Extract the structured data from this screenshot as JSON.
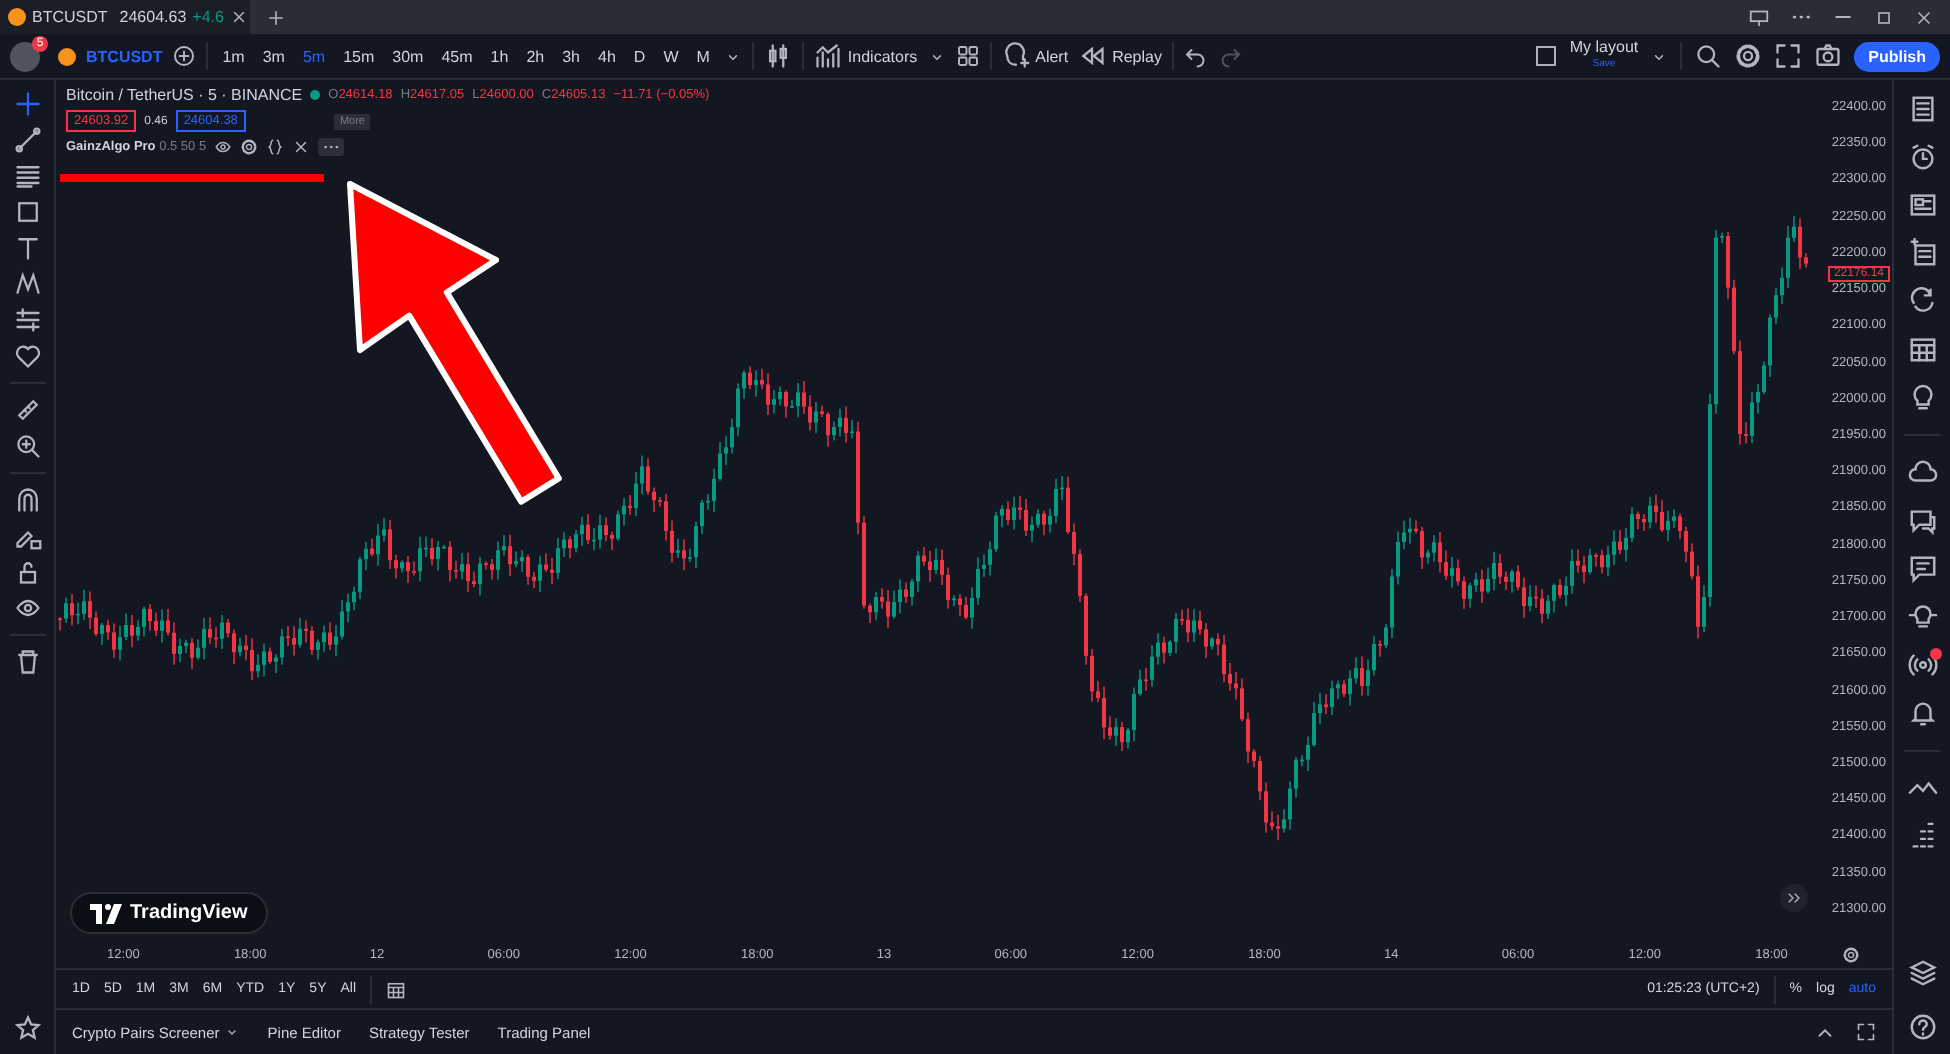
{
  "title_bar": {
    "tab": {
      "symbol": "BTCUSDT",
      "price": "24604.63",
      "change": "+4.6"
    }
  },
  "toolbar": {
    "notifications": "5",
    "symbol": "BTCUSDT",
    "intervals": [
      {
        "label": "1m",
        "selected": false
      },
      {
        "label": "3m",
        "selected": false
      },
      {
        "label": "5m",
        "selected": true
      },
      {
        "label": "15m",
        "selected": false
      },
      {
        "label": "30m",
        "selected": false
      },
      {
        "label": "45m",
        "selected": false
      },
      {
        "label": "1h",
        "selected": false
      },
      {
        "label": "2h",
        "selected": false
      },
      {
        "label": "3h",
        "selected": false
      },
      {
        "label": "4h",
        "selected": false
      },
      {
        "label": "D",
        "selected": false
      },
      {
        "label": "W",
        "selected": false
      },
      {
        "label": "M",
        "selected": false
      }
    ],
    "indicators": "Indicators",
    "alert": "Alert",
    "replay": "Replay",
    "layout": {
      "name": "My layout",
      "status": "Save"
    },
    "publish": "Publish"
  },
  "legend": {
    "title": "Bitcoin / TetherUS · 5 · BINANCE",
    "ohlc": [
      {
        "label": "O",
        "value": "24614.18"
      },
      {
        "label": "H",
        "value": "24617.05"
      },
      {
        "label": "L",
        "value": "24600.00"
      },
      {
        "label": "C",
        "value": "24605.13"
      }
    ],
    "change": "−11.71 (−0.05%)",
    "bid": "24603.92",
    "spread": "0.46",
    "ask": "24604.38",
    "tooltip": "More",
    "indicator": {
      "name": "GainzAlgo Pro",
      "params": "0.5 50 5"
    }
  },
  "logo": "TradingView",
  "price_axis": {
    "labels": [
      "22400.00",
      "22350.00",
      "22300.00",
      "22250.00",
      "22200.00",
      "22150.00",
      "22100.00",
      "22050.00",
      "22000.00",
      "21950.00",
      "21900.00",
      "21850.00",
      "21800.00",
      "21750.00",
      "21700.00",
      "21650.00",
      "21600.00",
      "21550.00",
      "21500.00",
      "21450.00",
      "21400.00",
      "21350.00",
      "21300.00"
    ],
    "current_price": "22176.14"
  },
  "time_axis": {
    "labels": [
      "12:00",
      "18:00",
      "12",
      "06:00",
      "12:00",
      "18:00",
      "13",
      "06:00",
      "12:00",
      "18:00",
      "14",
      "06:00",
      "12:00",
      "18:00"
    ]
  },
  "range_bar": {
    "ranges": [
      "1D",
      "5D",
      "1M",
      "3M",
      "6M",
      "YTD",
      "1Y",
      "5Y",
      "All"
    ],
    "clock": "01:25:23 (UTC+2)",
    "scale_options": [
      {
        "label": "%",
        "selected": false
      },
      {
        "label": "log",
        "selected": false
      },
      {
        "label": "auto",
        "selected": true
      }
    ]
  },
  "bottom_panel": {
    "tabs": [
      "Crypto Pairs Screener",
      "Pine Editor",
      "Strategy Tester",
      "Trading Panel"
    ]
  }
}
